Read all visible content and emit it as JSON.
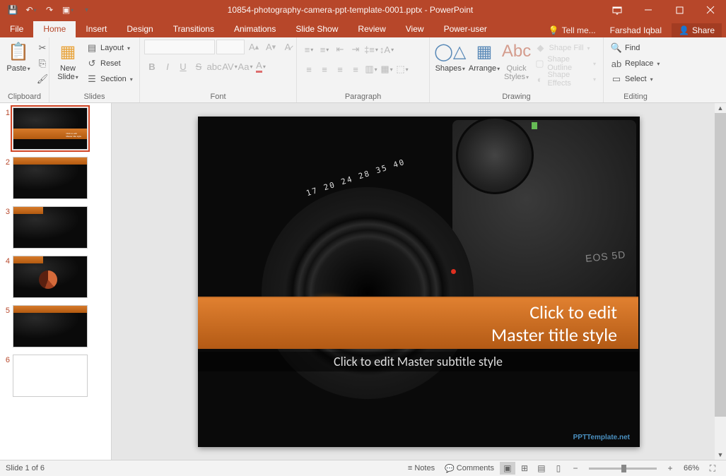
{
  "title": "10854-photography-camera-ppt-template-0001.pptx - PowerPoint",
  "user": "Farshad Iqbal",
  "tabs": {
    "file": "File",
    "home": "Home",
    "insert": "Insert",
    "design": "Design",
    "transitions": "Transitions",
    "animations": "Animations",
    "slideshow": "Slide Show",
    "review": "Review",
    "view": "View",
    "poweruser": "Power-user",
    "tellme": "Tell me...",
    "share": "Share"
  },
  "ribbon": {
    "clipboard": {
      "label": "Clipboard",
      "paste": "Paste"
    },
    "slides": {
      "label": "Slides",
      "newslide": "New\nSlide",
      "layout": "Layout",
      "reset": "Reset",
      "section": "Section"
    },
    "font": {
      "label": "Font"
    },
    "paragraph": {
      "label": "Paragraph"
    },
    "drawing": {
      "label": "Drawing",
      "shapes": "Shapes",
      "arrange": "Arrange",
      "quick": "Quick\nStyles",
      "fill": "Shape Fill",
      "outline": "Shape Outline",
      "effects": "Shape Effects"
    },
    "editing": {
      "label": "Editing",
      "find": "Find",
      "replace": "Replace",
      "select": "Select"
    }
  },
  "slide": {
    "title1": "Click to edit",
    "title2": "Master title style",
    "subtitle": "Click to edit Master subtitle style",
    "lensnums": "17 20 24 28  35 40",
    "eos": "EOS 5D",
    "watermark": "PPTTemplate.net"
  },
  "thumbs": [
    "1",
    "2",
    "3",
    "4",
    "5",
    "6"
  ],
  "status": {
    "slideinfo": "Slide 1 of 6",
    "notes": "Notes",
    "comments": "Comments",
    "zoom": "66%"
  }
}
